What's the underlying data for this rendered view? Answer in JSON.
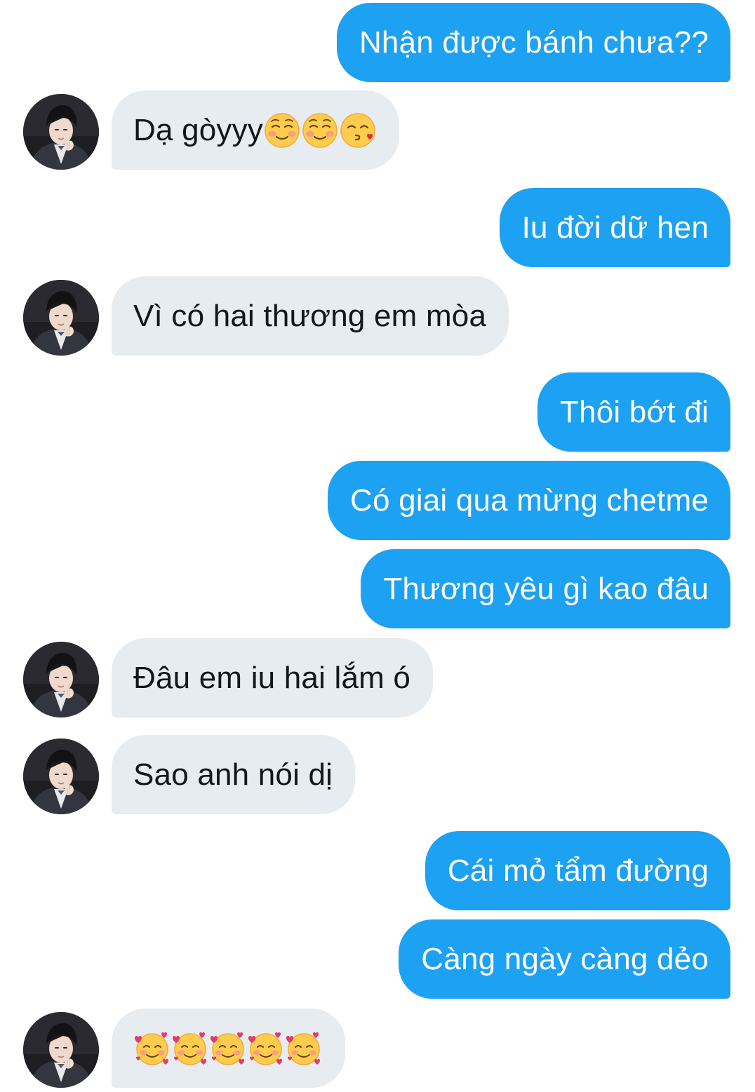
{
  "conversation": {
    "messages": [
      {
        "side": "out",
        "text": "Nhận được bánh chưa??"
      },
      {
        "side": "in",
        "text": "Dạ gòyyy",
        "emoji": [
          "smiling-blush-icon",
          "smiling-blush-icon",
          "kissing-icon"
        ]
      },
      {
        "side": "out",
        "text": "Iu đời dữ hen"
      },
      {
        "side": "in",
        "text": "Vì có hai thương em mòa"
      },
      {
        "side": "out",
        "text": "Thôi bớt đi"
      },
      {
        "side": "out",
        "text": "Có giai qua mừng chetme"
      },
      {
        "side": "out",
        "text": "Thương yêu gì kao đâu"
      },
      {
        "side": "in",
        "text": "Đâu em iu hai lắm ó"
      },
      {
        "side": "in",
        "text": "Sao anh nói dị"
      },
      {
        "side": "out",
        "text": "Cái mỏ tẩm đường"
      },
      {
        "side": "out",
        "text": "Càng ngày càng dẻo"
      },
      {
        "side": "in",
        "text": "",
        "emoji": [
          "smiling-hearts-icon",
          "smiling-hearts-icon",
          "smiling-hearts-icon",
          "smiling-hearts-icon",
          "smiling-hearts-icon"
        ]
      }
    ]
  },
  "colors": {
    "outgoing_bubble": "#1da1f2",
    "incoming_bubble": "#e6ecf0",
    "outgoing_text": "#ffffff",
    "incoming_text": "#14171a",
    "background": "#ffffff"
  }
}
